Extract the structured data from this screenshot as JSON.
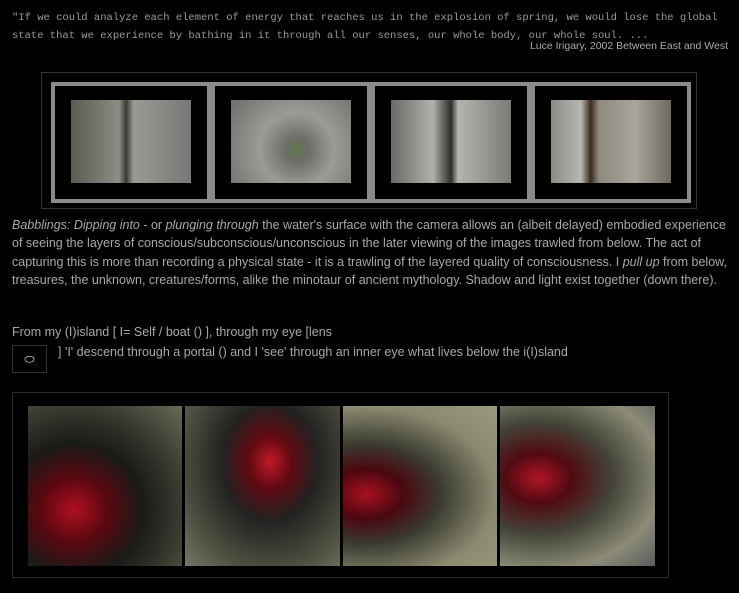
{
  "quote": {
    "text": "\"If we could analyze each element of energy that reaches us in the explosion of spring, we would lose the global state that we experience by bathing in it through all our senses, our whole body, our whole soul. ...",
    "citation": "Luce Irigary, 2002 Between East and West"
  },
  "paragraph": {
    "italic1": "Babblings: Dipping into",
    "t1": " - or ",
    "italic2": "plunging through",
    "t2": " the water's surface with the camera allows an (albeit delayed) embodied experience of seeing the layers of conscious/subconscious/unconscious in the later viewing of the images trawled from below. The act of capturing this is more than recording a physical state - it is a trawling of the layered quality of consciousness. I ",
    "italic3": "pull up",
    "t3": " from below, treasures, the unknown, creatures/forms, alike the minotaur of ancient mythology. Shadow and light exist together (down there)."
  },
  "island": {
    "line1": "From my (I)island [ I= Self / boat () ], through my eye [lens",
    "eye_glyph": "⬭",
    "line2": "] 'I' descend through a portal () and I 'see' through an inner eye what lives below the i(I)sland"
  }
}
